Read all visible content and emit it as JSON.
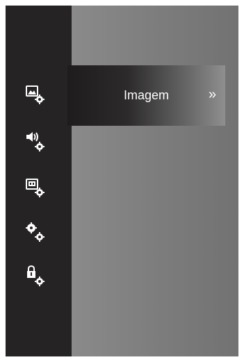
{
  "sidebar": {
    "items": [
      {
        "name": "image-settings",
        "icon": "image-gear-icon"
      },
      {
        "name": "audio-settings",
        "icon": "speaker-gear-icon"
      },
      {
        "name": "channel-settings",
        "icon": "channel-gear-icon"
      },
      {
        "name": "general-settings",
        "icon": "gears-icon"
      },
      {
        "name": "lock-settings",
        "icon": "lock-gear-icon"
      }
    ]
  },
  "menu": {
    "selected_label": "Imagem",
    "chevron": "»"
  },
  "colors": {
    "sidebar_bg": "#252324",
    "content_bg": "#808080",
    "text": "#ffffff"
  }
}
